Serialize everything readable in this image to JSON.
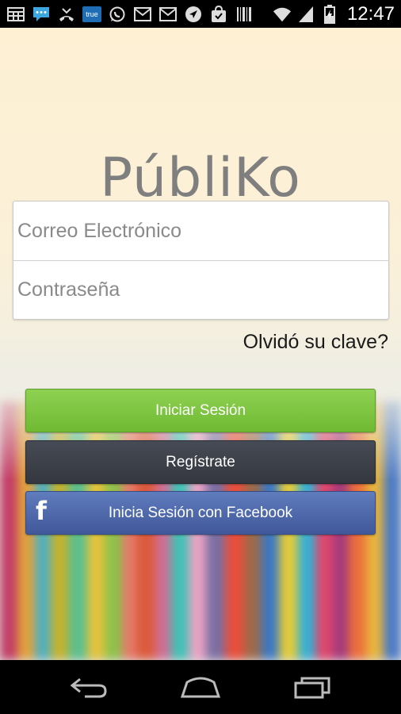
{
  "status_bar": {
    "time": "12:47",
    "left_icons": [
      "calendar-grid-icon",
      "sms-icon",
      "missed-call-icon",
      "true-app-icon",
      "whatsapp-icon",
      "gmail-icon",
      "gmail-icon",
      "navigation-icon",
      "shopping-bag-icon",
      "barcode-icon"
    ],
    "true_label": "true",
    "right_icons": [
      "wifi-icon",
      "signal-icon",
      "battery-charging-icon"
    ]
  },
  "app": {
    "logo": "PúbliKo",
    "email_placeholder": "Correo Electrónico",
    "password_placeholder": "Contraseña",
    "forgot_link": "Olvidó su clave?",
    "login_button": "Iniciar Sesión",
    "register_button": "Regístrate",
    "facebook_button": "Inicia Sesión con Facebook",
    "facebook_icon": "f"
  },
  "colors": {
    "login": "#79c23c",
    "register": "#3c3f47",
    "facebook": "#4d67a8",
    "logo": "#7f7f7f"
  },
  "nav_bar": {
    "icons": [
      "back-icon",
      "home-icon",
      "recent-apps-icon"
    ]
  }
}
